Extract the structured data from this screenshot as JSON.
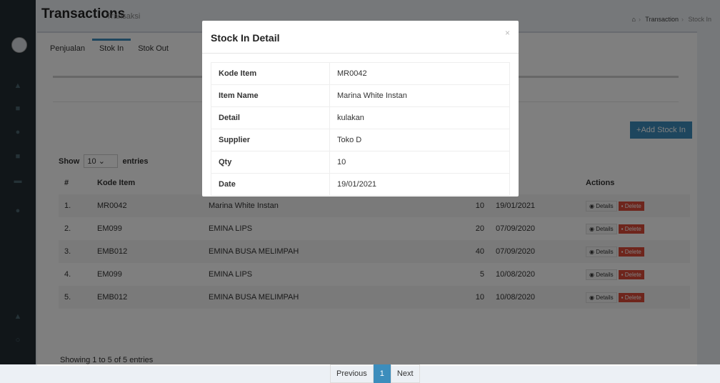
{
  "header": {
    "title": "Transactions",
    "subtitle": "Transaksi"
  },
  "breadcrumb": [
    "Transaction",
    "Stock In"
  ],
  "tabs": [
    "Penjualan",
    "Stok In",
    "Stok Out"
  ],
  "add_button": "Add Stock In",
  "show_entries": {
    "label_show": "Show",
    "value": "10",
    "label_entries": "entries"
  },
  "table": {
    "headers": [
      "#",
      "Kode Item",
      "",
      "",
      "",
      "Actions"
    ],
    "rows": [
      {
        "no": "1.",
        "kode": "MR0042",
        "name": "Marina White Instan",
        "qty": "10",
        "date": "19/01/2021"
      },
      {
        "no": "2.",
        "kode": "EM099",
        "name": "EMINA LIPS",
        "qty": "20",
        "date": "07/09/2020"
      },
      {
        "no": "3.",
        "kode": "EMB012",
        "name": "EMINA BUSA MELIMPAH",
        "qty": "40",
        "date": "07/09/2020"
      },
      {
        "no": "4.",
        "kode": "EM099",
        "name": "EMINA LIPS",
        "qty": "5",
        "date": "10/08/2020"
      },
      {
        "no": "5.",
        "kode": "EMB012",
        "name": "EMINA BUSA MELIMPAH",
        "qty": "10",
        "date": "10/08/2020"
      }
    ],
    "details_label": "Details",
    "delete_label": "Delete"
  },
  "info": "Showing 1 to 5 of 5 entries",
  "pager": {
    "prev": "Previous",
    "page": "1",
    "next": "Next"
  },
  "modal": {
    "title": "Stock In Detail",
    "close": "×",
    "rows": [
      {
        "k": "Kode Item",
        "v": "MR0042"
      },
      {
        "k": "Item Name",
        "v": "Marina White Instan"
      },
      {
        "k": "Detail",
        "v": "kulakan"
      },
      {
        "k": "Supplier",
        "v": "Toko D"
      },
      {
        "k": "Qty",
        "v": "10"
      },
      {
        "k": "Date",
        "v": "19/01/2021"
      }
    ]
  }
}
